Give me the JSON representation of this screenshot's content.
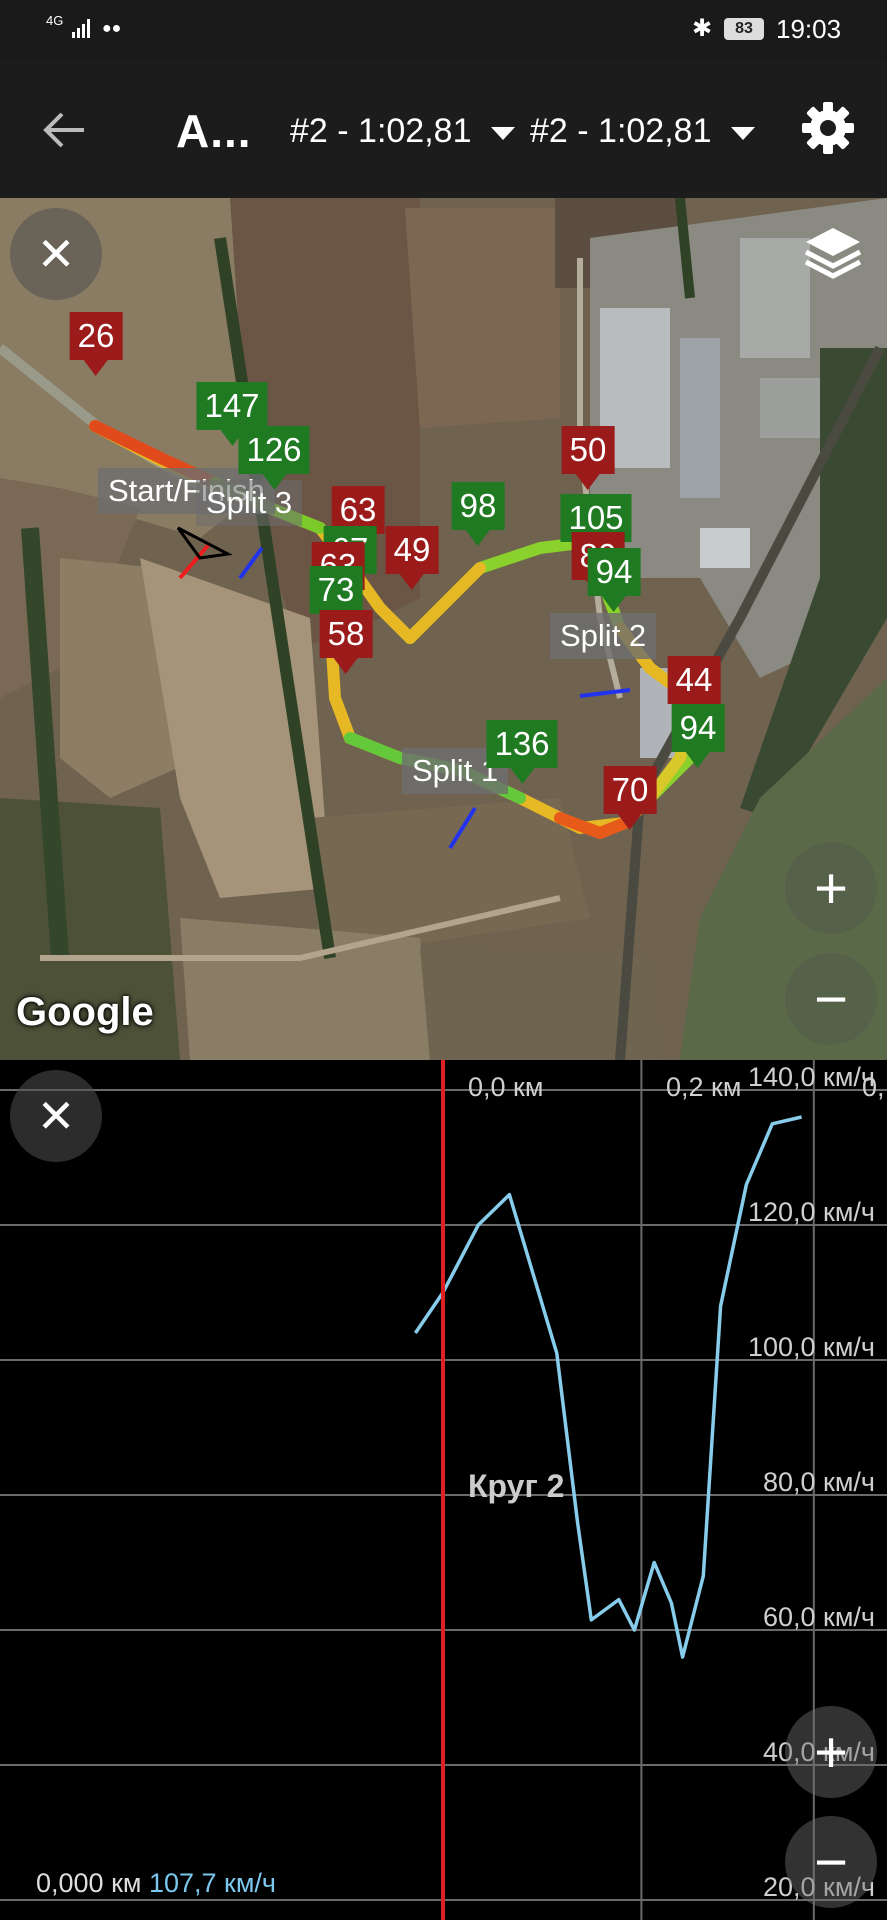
{
  "status_bar": {
    "network": "4G",
    "battery": "83",
    "time": "19:03"
  },
  "app_bar": {
    "title": "A...",
    "lap_select_1": "#2 - 1:02,81",
    "lap_select_2": "#2 - 1:02,81"
  },
  "map": {
    "google_label": "Google",
    "zoom_in": "+",
    "zoom_out": "−",
    "close": "✕",
    "split_labels": [
      "Start/Finish",
      "Split 3",
      "Split 2",
      "Split 1"
    ],
    "speed_markers": [
      {
        "value": "26",
        "kind": "min"
      },
      {
        "value": "147",
        "kind": "max"
      },
      {
        "value": "126",
        "kind": "max"
      },
      {
        "value": "63",
        "kind": "min"
      },
      {
        "value": "67",
        "kind": "max"
      },
      {
        "value": "63",
        "kind": "min"
      },
      {
        "value": "49",
        "kind": "min"
      },
      {
        "value": "73",
        "kind": "max"
      },
      {
        "value": "58",
        "kind": "min"
      },
      {
        "value": "98",
        "kind": "max"
      },
      {
        "value": "50",
        "kind": "min"
      },
      {
        "value": "105",
        "kind": "max"
      },
      {
        "value": "80",
        "kind": "min"
      },
      {
        "value": "94",
        "kind": "max"
      },
      {
        "value": "44",
        "kind": "min"
      },
      {
        "value": "94",
        "kind": "max"
      },
      {
        "value": "136",
        "kind": "max"
      },
      {
        "value": "70",
        "kind": "min"
      }
    ]
  },
  "chart": {
    "close": "✕",
    "zoom_in": "+",
    "zoom_out": "−",
    "lap_label": "Круг 2",
    "cursor_distance": "0,000 км",
    "cursor_speed": "107,7 км/ч"
  },
  "chart_data": {
    "type": "line",
    "title": "",
    "xlabel": "",
    "ylabel": "",
    "x_tick_labels": [
      "0,0 км",
      "0,2 км",
      "0,"
    ],
    "y_tick_labels": [
      "140,0 км/ч",
      "120,0 км/ч",
      "100,0 км/ч",
      "80,0 км/ч",
      "60,0 км/ч",
      "40,0 км/ч",
      "20,0 км/ч"
    ],
    "y_ticks": [
      140,
      120,
      100,
      80,
      60,
      40,
      20
    ],
    "ylim": [
      20,
      140
    ],
    "xlim": [
      -0.032,
      0.4
    ],
    "grid": true,
    "series": [
      {
        "color": "#87cdeb",
        "x": [
          -0.032,
          0.0,
          0.041,
          0.077,
          0.132,
          0.156,
          0.172,
          0.204,
          0.222,
          0.245,
          0.265,
          0.278,
          0.302,
          0.322,
          0.352,
          0.382,
          0.416
        ],
        "y": [
          104,
          110,
          120,
          124.5,
          101,
          76,
          61.5,
          64.5,
          60,
          70,
          64,
          56,
          68,
          108,
          126,
          135,
          136
        ]
      }
    ],
    "cursor_x": 0.0,
    "cursor_color": "#e02020"
  }
}
